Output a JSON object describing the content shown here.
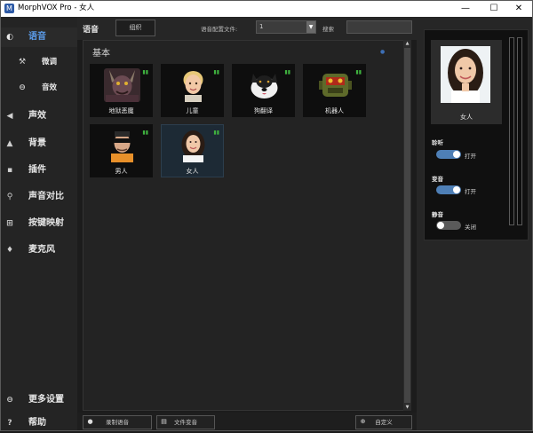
{
  "window": {
    "title": "MorphVOX Pro - 女人",
    "app_icon": "morphvox-app-icon",
    "controls": {
      "minimize": "—",
      "maximize": "☐",
      "close": "✕"
    }
  },
  "sidebar": {
    "items": [
      {
        "key": "voice",
        "label": "语音",
        "icon": "voice-icon",
        "glyph": "◐",
        "active": true
      },
      {
        "key": "tweak",
        "label": "微调",
        "icon": "tools-icon",
        "glyph": "⚒",
        "sub": true
      },
      {
        "key": "sound",
        "label": "音效",
        "icon": "ring-icon",
        "glyph": "⊖",
        "sub": true
      },
      {
        "key": "effects",
        "label": "声效",
        "icon": "speaker-icon",
        "glyph": "◀"
      },
      {
        "key": "background",
        "label": "背景",
        "icon": "landscape-icon",
        "glyph": "▲"
      },
      {
        "key": "plugins",
        "label": "插件",
        "icon": "plug-icon",
        "glyph": "▪"
      },
      {
        "key": "compare",
        "label": "声音对比",
        "icon": "search-icon",
        "glyph": "⚲"
      },
      {
        "key": "keymap",
        "label": "按键映射",
        "icon": "keyboard-icon",
        "glyph": "⊞"
      },
      {
        "key": "mic",
        "label": "麦克风",
        "icon": "microphone-icon",
        "glyph": "♦"
      },
      {
        "key": "more",
        "label": "更多设置",
        "icon": "settings-icon",
        "glyph": "⊖"
      },
      {
        "key": "help",
        "label": "帮助",
        "icon": "help-icon",
        "glyph": "?"
      }
    ]
  },
  "topbar": {
    "voice_label": "语音",
    "organize_label": "组织",
    "profile_label": "语音配置文件:",
    "profile_value": "1",
    "search_label": "搜索",
    "search_value": ""
  },
  "library": {
    "section_title": "基本",
    "collapse_icon": "collapse-dot-icon",
    "voices": [
      {
        "name": "地狱恶魔",
        "portrait": "demon",
        "selected": false
      },
      {
        "name": "儿童",
        "portrait": "child",
        "selected": false
      },
      {
        "name": "狗翻译",
        "portrait": "dog",
        "selected": false
      },
      {
        "name": "机器人",
        "portrait": "robot",
        "selected": false
      },
      {
        "name": "男人",
        "portrait": "man",
        "selected": false
      },
      {
        "name": "女人",
        "portrait": "woman",
        "selected": true
      }
    ]
  },
  "bottombar": {
    "record_label": "录制语音",
    "file_label": "文件变音",
    "custom_label": "自定义"
  },
  "rightpanel": {
    "selected_voice": "女人",
    "listen": {
      "label": "聆听",
      "state": "打开",
      "on": true
    },
    "morph": {
      "label": "变音",
      "state": "打开",
      "on": true
    },
    "mute": {
      "label": "静音",
      "state": "关闭",
      "on": false
    }
  }
}
